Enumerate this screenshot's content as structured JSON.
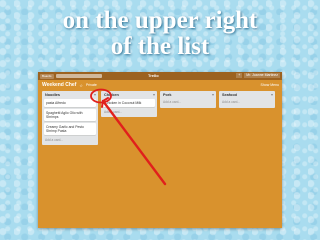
{
  "caption": {
    "line1": "on the upper right",
    "line2": "of  the list"
  },
  "app": {
    "topbar": {
      "boards_label": "Boards",
      "logo": "Trello",
      "user": "Mr. Joanne Martinez"
    },
    "board": {
      "title": "Weekend Chef",
      "privacy": "Private",
      "show_menu": "Show Menu"
    },
    "lists": [
      {
        "title": "Noodles",
        "cards": [
          "pasta Alfredo",
          "Spaghetti Aglio Olio with Shrimps",
          "Creamy Garlic and Pesto Shrimp Pasta"
        ],
        "add_label": "Add a card..."
      },
      {
        "title": "Chicken",
        "cards": [
          "Chicken in Coconut Milk"
        ],
        "add_label": "Add a card..."
      },
      {
        "title": "Pork",
        "cards": [],
        "add_label": "Add a card..."
      },
      {
        "title": "Seafood",
        "cards": [],
        "add_label": "Add a card..."
      }
    ]
  },
  "colors": {
    "board_bg": "#d9922d",
    "topbar": "#9c6220",
    "arrow": "#e0201c",
    "slide_bg": "#a9dcef"
  }
}
